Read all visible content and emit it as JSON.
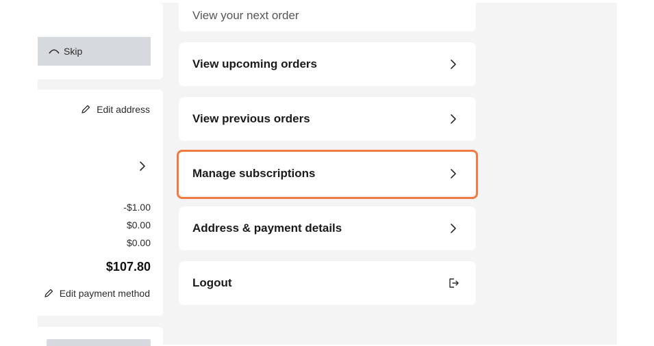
{
  "left_panel": {
    "skip_label": "Skip",
    "edit_address_label": "Edit address",
    "amounts": [
      "-$1.00",
      "$0.00",
      "$0.00"
    ],
    "total": "$107.80",
    "edit_payment_label": "Edit payment method"
  },
  "menu": {
    "next_order_label": "View your next order",
    "items": [
      {
        "label": "View upcoming orders"
      },
      {
        "label": "View previous orders"
      },
      {
        "label": "Manage subscriptions"
      },
      {
        "label": "Address & payment details"
      },
      {
        "label": "Logout"
      }
    ]
  },
  "colors": {
    "highlight": "#f07b42",
    "page_background": "#f4f4f4",
    "skip_button": "#d6d9dd"
  }
}
